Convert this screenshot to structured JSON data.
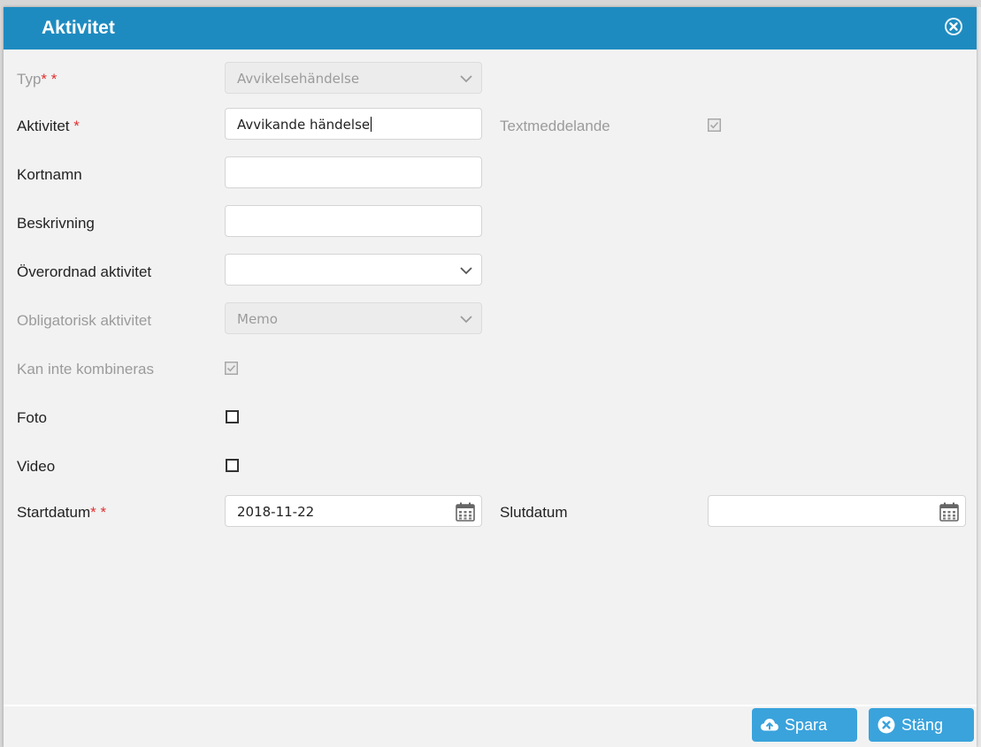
{
  "dialog": {
    "title": "Aktivitet",
    "close_icon": "close-circle-icon"
  },
  "form": {
    "typ": {
      "label": "Typ",
      "required_marks": [
        "*",
        "*"
      ],
      "value": "Avvikelsehändelse",
      "disabled": true
    },
    "aktivitet": {
      "label": "Aktivitet",
      "required_mark": "*",
      "value": "Avvikande händelse"
    },
    "textmeddelande": {
      "label": "Textmeddelande",
      "checked": true,
      "disabled": true
    },
    "kortnamn": {
      "label": "Kortnamn",
      "value": ""
    },
    "beskrivning": {
      "label": "Beskrivning",
      "value": ""
    },
    "overordnad": {
      "label": "Överordnad aktivitet",
      "value": ""
    },
    "obligatorisk": {
      "label": "Obligatorisk aktivitet",
      "value": "Memo",
      "disabled": true
    },
    "kan_inte": {
      "label": "Kan inte kombineras",
      "checked": true,
      "disabled": true
    },
    "foto": {
      "label": "Foto",
      "checked": false
    },
    "video": {
      "label": "Video",
      "checked": false
    },
    "startdatum": {
      "label": "Startdatum",
      "required_marks": [
        "*",
        "*"
      ],
      "value": "2018-11-22"
    },
    "slutdatum": {
      "label": "Slutdatum",
      "value": ""
    }
  },
  "buttons": {
    "save": {
      "label": "Spara",
      "icon": "cloud-upload-icon"
    },
    "close": {
      "label": "Stäng",
      "icon": "close-circle-icon"
    }
  },
  "colors": {
    "titlebar": "#1e8bc0",
    "button": "#3aa3dc",
    "required": "#e03030"
  }
}
